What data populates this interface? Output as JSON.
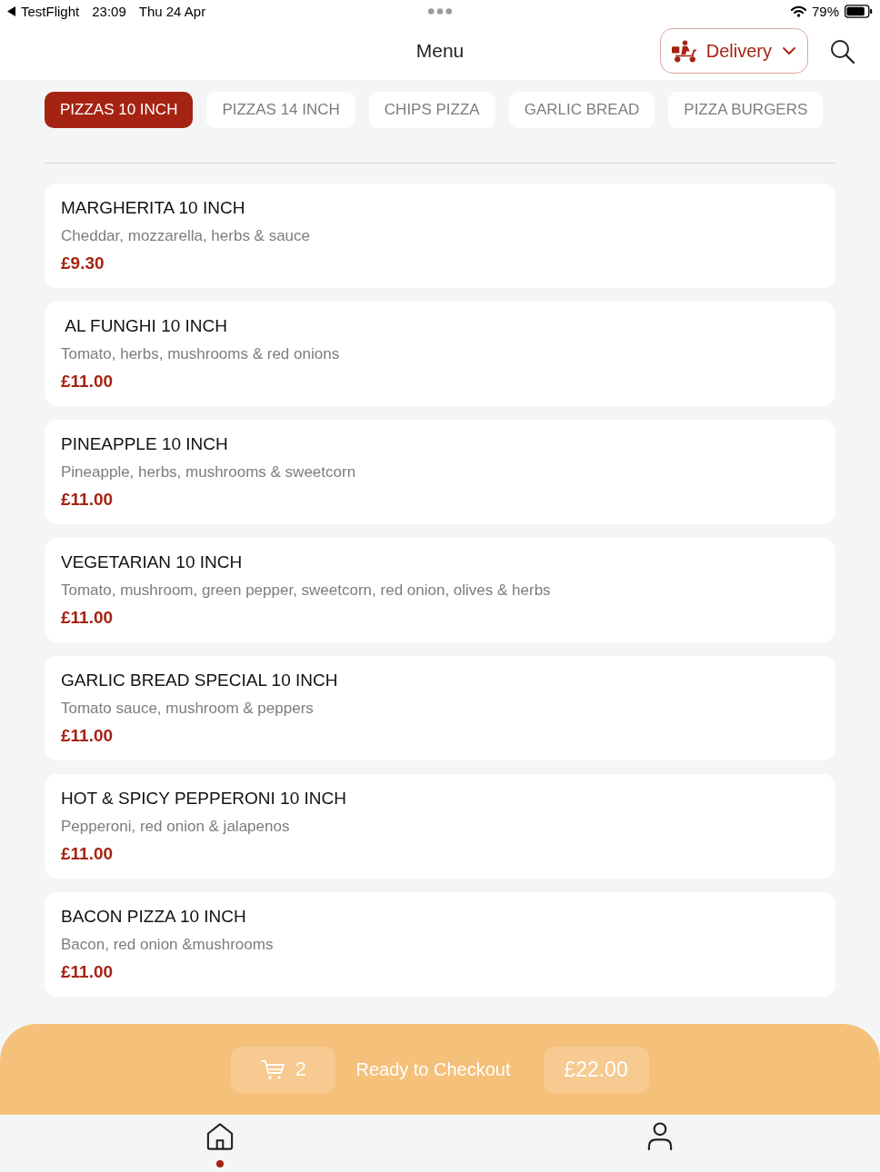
{
  "status_bar": {
    "back_app": "TestFlight",
    "time": "23:09",
    "date": "Thu 24 Apr",
    "battery": "79%"
  },
  "header": {
    "title": "Menu",
    "order_mode": "Delivery"
  },
  "category_tabs": [
    {
      "label": "PIZZAS 10 INCH",
      "selected": true
    },
    {
      "label": "PIZZAS 14 INCH",
      "selected": false
    },
    {
      "label": "CHIPS PIZZA",
      "selected": false
    },
    {
      "label": "GARLIC BREAD",
      "selected": false
    },
    {
      "label": "PIZZA BURGERS",
      "selected": false
    }
  ],
  "menu_items": [
    {
      "name": "MARGHERITA 10 INCH",
      "description": "Cheddar, mozzarella, herbs & sauce",
      "price": "£9.30"
    },
    {
      "name": " AL FUNGHI 10 INCH",
      "description": "Tomato, herbs, mushrooms & red onions",
      "price": "£11.00"
    },
    {
      "name": "PINEAPPLE 10 INCH",
      "description": "Pineapple, herbs, mushrooms & sweetcorn",
      "price": "£11.00"
    },
    {
      "name": "VEGETARIAN 10 INCH",
      "description": "Tomato, mushroom, green pepper, sweetcorn, red onion, olives & herbs",
      "price": "£11.00"
    },
    {
      "name": "GARLIC BREAD SPECIAL 10 INCH",
      "description": "Tomato sauce, mushroom & peppers",
      "price": "£11.00"
    },
    {
      "name": "HOT & SPICY PEPPERONI 10 INCH",
      "description": "Pepperoni, red onion & jalapenos",
      "price": "£11.00"
    },
    {
      "name": "BACON PIZZA 10 INCH",
      "description": "Bacon, red onion &mushrooms",
      "price": "£11.00"
    }
  ],
  "checkout_bar": {
    "count": "2",
    "label": "Ready to Checkout",
    "total": "£22.00"
  },
  "bottom_nav": [
    {
      "kind": "home",
      "selected": true
    },
    {
      "kind": "account",
      "selected": false
    }
  ]
}
